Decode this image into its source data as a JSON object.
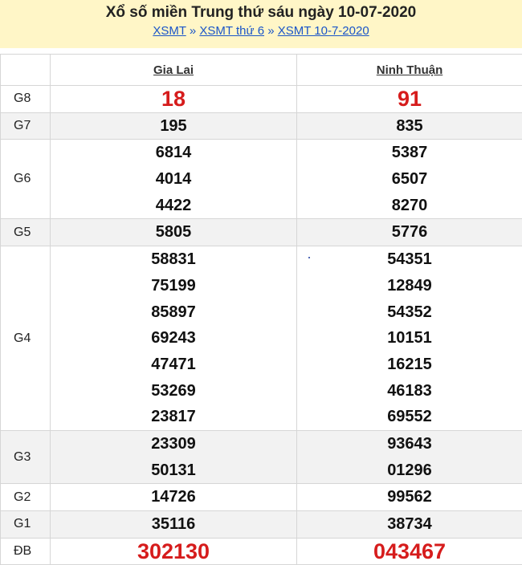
{
  "header": {
    "title": "Xổ số miền Trung thứ sáu ngày 10-07-2020",
    "breadcrumb": [
      "XSMT",
      "XSMT thứ 6",
      "XSMT 10-7-2020"
    ],
    "separator": "»"
  },
  "provinces": [
    "Gia Lai",
    "Ninh Thuận"
  ],
  "prizes": [
    {
      "label": "G8",
      "gia_lai": [
        "18"
      ],
      "ninh_thuan": [
        "91"
      ]
    },
    {
      "label": "G7",
      "gia_lai": [
        "195"
      ],
      "ninh_thuan": [
        "835"
      ]
    },
    {
      "label": "G6",
      "gia_lai": [
        "6814",
        "4014",
        "4422"
      ],
      "ninh_thuan": [
        "5387",
        "6507",
        "8270"
      ]
    },
    {
      "label": "G5",
      "gia_lai": [
        "5805"
      ],
      "ninh_thuan": [
        "5776"
      ]
    },
    {
      "label": "G4",
      "gia_lai": [
        "58831",
        "75199",
        "85897",
        "69243",
        "47471",
        "53269",
        "23817"
      ],
      "ninh_thuan": [
        "54351",
        "12849",
        "54352",
        "10151",
        "16215",
        "46183",
        "69552"
      ]
    },
    {
      "label": "G3",
      "gia_lai": [
        "23309",
        "50131"
      ],
      "ninh_thuan": [
        "93643",
        "01296"
      ]
    },
    {
      "label": "G2",
      "gia_lai": [
        "14726"
      ],
      "ninh_thuan": [
        "99562"
      ]
    },
    {
      "label": "G1",
      "gia_lai": [
        "35116"
      ],
      "ninh_thuan": [
        "38734"
      ]
    },
    {
      "label": "ĐB",
      "gia_lai": [
        "302130"
      ],
      "ninh_thuan": [
        "043467"
      ]
    }
  ],
  "colors": {
    "header_bg": "#fff6c7",
    "link": "#1a55c8",
    "highlight": "#d61c1c",
    "shade": "#f2f2f2"
  }
}
